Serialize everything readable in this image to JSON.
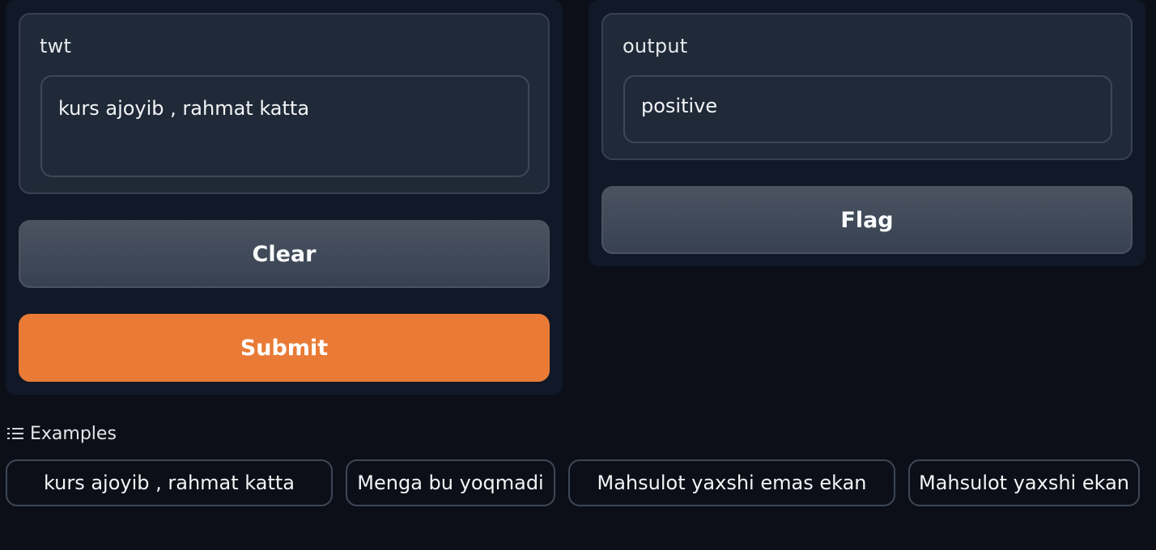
{
  "input": {
    "label": "twt",
    "value": "kurs ajoyib , rahmat katta"
  },
  "output": {
    "label": "output",
    "value": "positive"
  },
  "buttons": {
    "clear": "Clear",
    "submit": "Submit",
    "flag": "Flag"
  },
  "examples": {
    "header": "Examples",
    "header_icon": "list-icon",
    "items": [
      "kurs ajoyib , rahmat katta",
      "Menga bu yoqmadi",
      "Mahsulot yaxshi emas ekan",
      "Mahsulot yaxshi ekan"
    ]
  },
  "colors": {
    "background": "#0c0f17",
    "panel": "#111827",
    "block": "#1f2937",
    "primary": "#e97b36",
    "secondary": "#4b5361"
  }
}
